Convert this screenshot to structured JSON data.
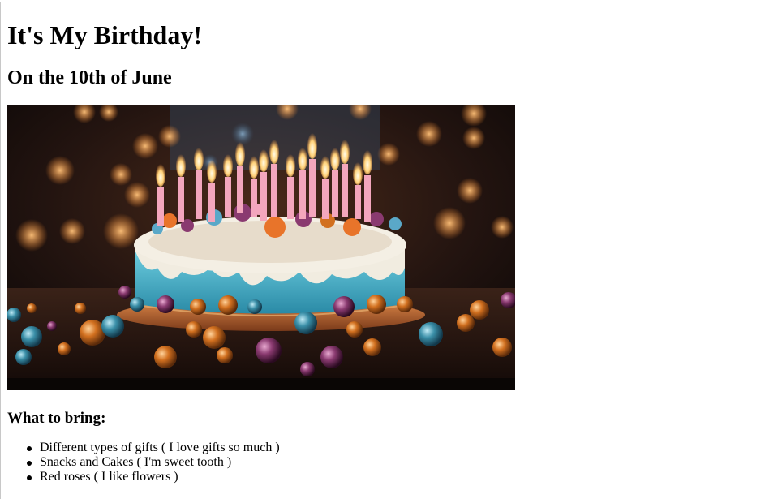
{
  "page": {
    "title": "It's My Birthday!",
    "subtitle": "On the 10th of June",
    "image": {
      "subject": "birthday-cake-with-candles",
      "colors": {
        "background": "#1a0f0c",
        "frosting_blue": "#3fb0c8",
        "frosting_cream": "#f1ece0",
        "candle_pink": "#f3a6bd",
        "flame": "#ffd27a",
        "ornament_copper": "#d2701f",
        "ornament_teal": "#3a8fa8"
      }
    },
    "bring_heading": "What to bring:",
    "bring_items": [
      "Different types of gifts ( I love gifts so much )",
      "Snacks and Cakes ( I'm sweet tooth )",
      "Red roses ( I like flowers )"
    ]
  }
}
